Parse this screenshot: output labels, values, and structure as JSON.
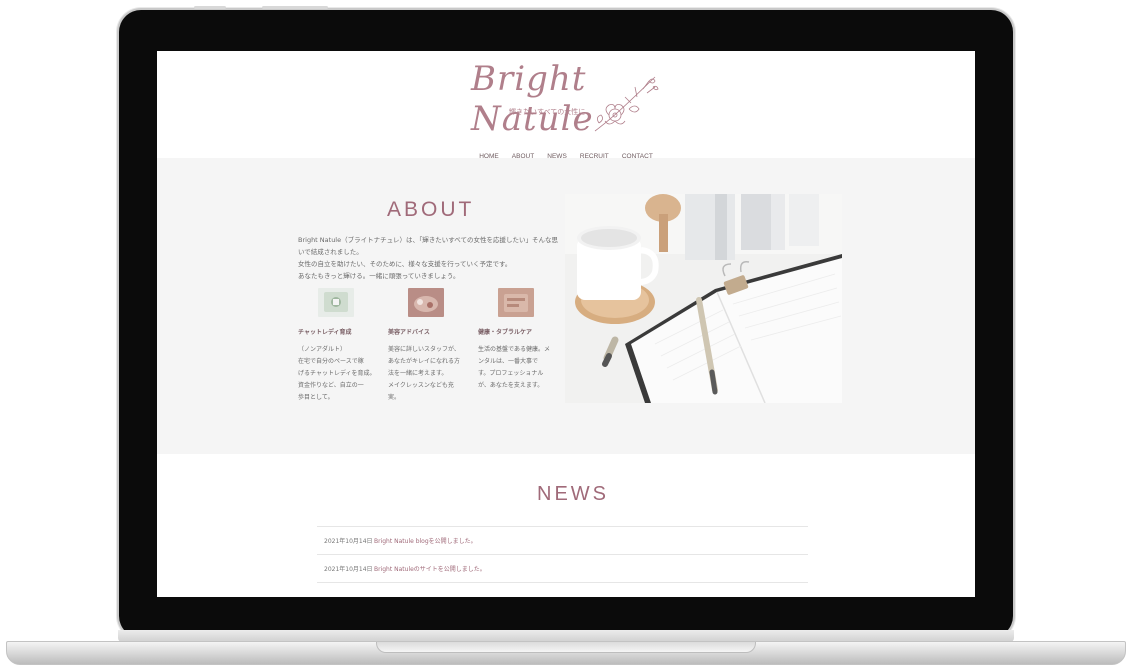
{
  "site": {
    "logo_text": "Bright Natule",
    "logo_tagline": "輝きたいすべての女性に"
  },
  "nav": {
    "items": [
      "HOME",
      "ABOUT",
      "NEWS",
      "RECRUIT",
      "CONTACT"
    ]
  },
  "about": {
    "title": "ABOUT",
    "description_lines": [
      "Bright Natule（ブライトナチュレ）は、「輝きたいすべての女性を応援したい」そんな思",
      "いで結成されました。",
      "女性の自立を助けたい、そのために、様々な支援を行っていく予定です。",
      "あなたもきっと輝ける。一緒に頑張っていきましょう。"
    ],
    "features": [
      {
        "title": "チャットレディ育成",
        "body_lines": [
          "（ノンアダルト）",
          "在宅で自分のペースで稼",
          "げるチャットレディを育成。",
          "資金作りなど、自立の一",
          "歩目として。"
        ]
      },
      {
        "title": "美容アドバイス",
        "body_lines": [
          "美容に詳しいスタッフが、",
          "あなたがキレイになれる方",
          "法を一緒に考えます。",
          "メイクレッスンなども充",
          "実。"
        ]
      },
      {
        "title": "健康・タブラルケア",
        "body_lines": [
          "生活の基盤である健康。メ",
          "ンタルは、一番大事で",
          "す。プロフェッショナル",
          "が、あなたを支えます。"
        ]
      }
    ]
  },
  "news": {
    "title": "NEWS",
    "items": [
      {
        "date": "2021年10月14日",
        "text": "Bright Natule blogを公開しました。"
      },
      {
        "date": "2021年10月14日",
        "text": "Bright Natuleのサイトを公開しました。"
      }
    ]
  },
  "colors": {
    "accent": "#a06a79",
    "section_bg": "#f5f5f5",
    "frame": "#0b0b0b"
  }
}
